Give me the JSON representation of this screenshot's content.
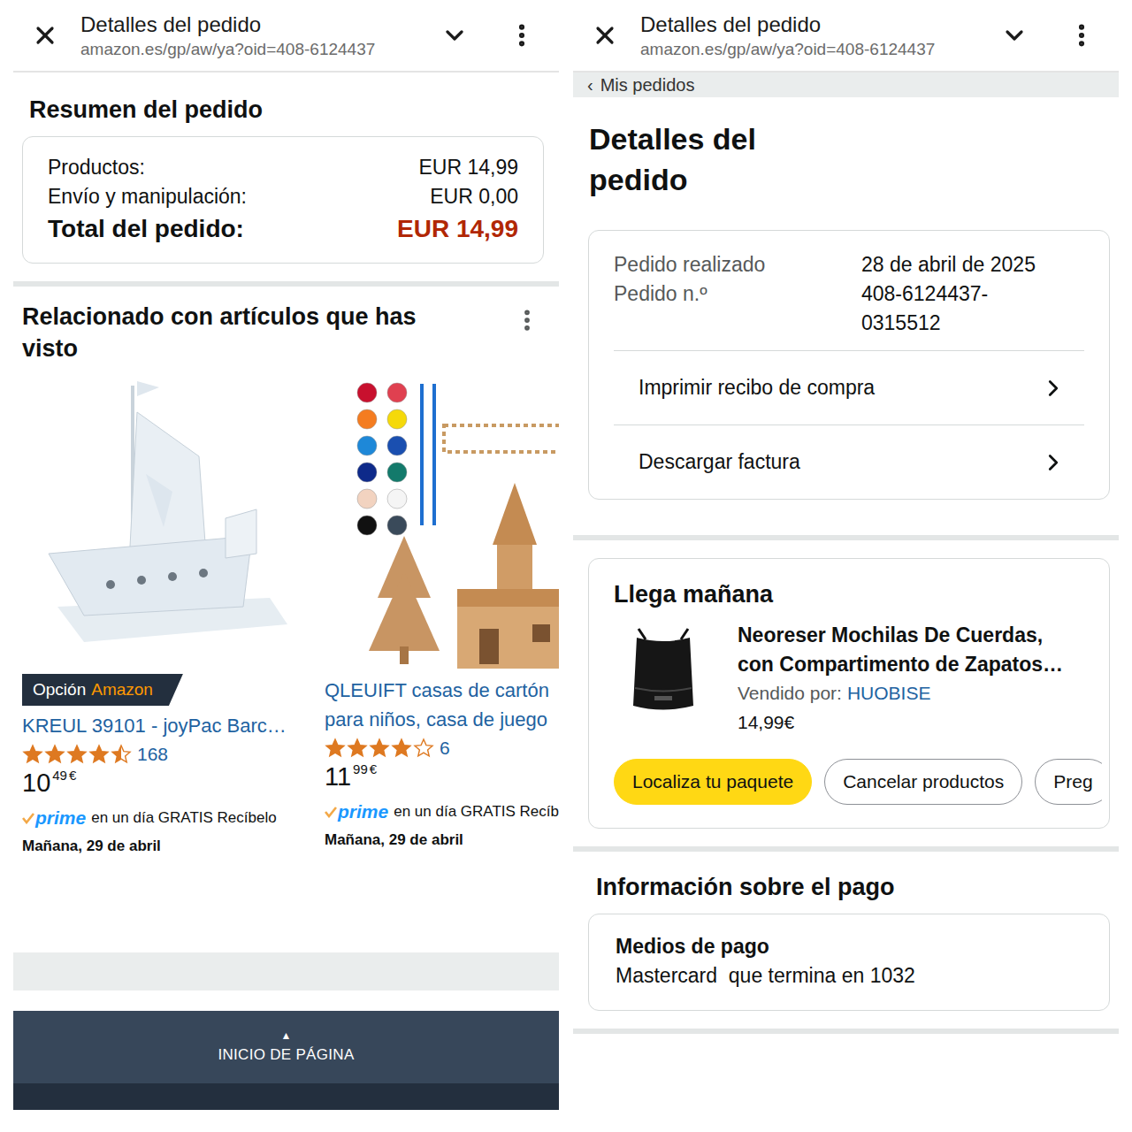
{
  "left": {
    "browser": {
      "title": "Detalles del pedido",
      "url": "amazon.es/gp/aw/ya?oid=408-6124437"
    },
    "summary": {
      "title": "Resumen del pedido",
      "rows": [
        {
          "label": "Productos:",
          "value": "EUR 14,99",
          "kind": "normal"
        },
        {
          "label": "Envío y manipulación:",
          "value": "EUR 0,00",
          "kind": "normal"
        },
        {
          "label": "Total del pedido:",
          "value": "EUR 14,99",
          "kind": "total"
        }
      ]
    },
    "related": {
      "title": "Relacionado con artículos que has visto",
      "products": [
        {
          "kind": "ship",
          "badge": {
            "prefix": "Opción",
            "brand": "Amazon"
          },
          "name": "KREUL 39101 - joyPac Barc…",
          "stars": 4.5,
          "reviews": "168",
          "price": {
            "whole": "10",
            "fraction": "49",
            "currency": "€"
          },
          "prime": "prime",
          "delivery_text": "en un día GRATIS Recíbelo",
          "delivery_date": "Mañana, 29 de abril"
        },
        {
          "kind": "house",
          "badge": null,
          "name": "QLEUIFT casas de cartón para niños, casa de juego",
          "stars": 4,
          "reviews": "6",
          "price": {
            "whole": "11",
            "fraction": "99",
            "currency": "€"
          },
          "prime": "prime",
          "delivery_text": "en un día GRATIS Recíb",
          "delivery_date": "Mañana, 29 de abril"
        }
      ]
    },
    "footer": {
      "arrow": "▲",
      "label": "INICIO DE PÁGINA"
    }
  },
  "right": {
    "browser": {
      "title": "Detalles del pedido",
      "url": "amazon.es/gp/aw/ya?oid=408-6124437"
    },
    "back": {
      "icon": "‹",
      "label": "Mis pedidos"
    },
    "title": "Detalles del pedido",
    "order": {
      "rows": [
        {
          "label": "Pedido realizado",
          "value": "28 de abril de 2025"
        },
        {
          "label": "Pedido n.º",
          "value": "408-6124437-0315512"
        }
      ],
      "links": [
        "Imprimir recibo de compra",
        "Descargar factura"
      ]
    },
    "shipment": {
      "title": "Llega mañana",
      "item": {
        "name": "Neoreser Mochilas De Cuerdas, con Compartimento de Zapatos…",
        "seller_label": "Vendido por:",
        "seller": "HUOBISE",
        "price": "14,99€"
      },
      "buttons": [
        {
          "label": "Localiza tu paquete",
          "kind": "primary"
        },
        {
          "label": "Cancelar productos",
          "kind": "secondary"
        },
        {
          "label": "Preg",
          "kind": "secondary"
        }
      ]
    },
    "payment": {
      "title": "Información sobre el pago",
      "card_title": "Medios de pago",
      "method": "Mastercard  que termina en 1032"
    }
  }
}
